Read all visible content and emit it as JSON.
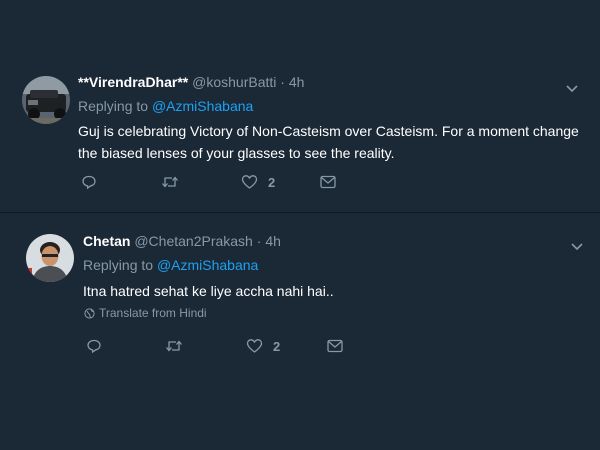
{
  "tweets": [
    {
      "name": "**VirendraDhar**",
      "handle": "@koshurBatti",
      "separator": "·",
      "time": "4h",
      "replying_prefix": "Replying to",
      "replying_to": "@AzmiShabana",
      "text": "Guj is celebrating Victory of Non-Casteism over Casteism. For a moment change the biased lenses of your glasses to see the reality.",
      "like_count": "2"
    },
    {
      "name": "Chetan",
      "handle": "@Chetan2Prakash",
      "separator": "·",
      "time": "4h",
      "replying_prefix": "Replying to",
      "replying_to": "@AzmiShabana",
      "text": "Itna hatred sehat ke liye accha nahi hai..",
      "translate_label": "Translate from Hindi",
      "like_count": "2"
    }
  ],
  "icons": {
    "reply": "reply-icon",
    "retweet": "retweet-icon",
    "like": "heart-icon",
    "dm": "envelope-icon",
    "more": "chevron-down-icon",
    "globe": "globe-icon"
  },
  "colors": {
    "background": "#1b2836",
    "text": "#ffffff",
    "muted": "#8899a6",
    "link": "#1da1f2"
  }
}
